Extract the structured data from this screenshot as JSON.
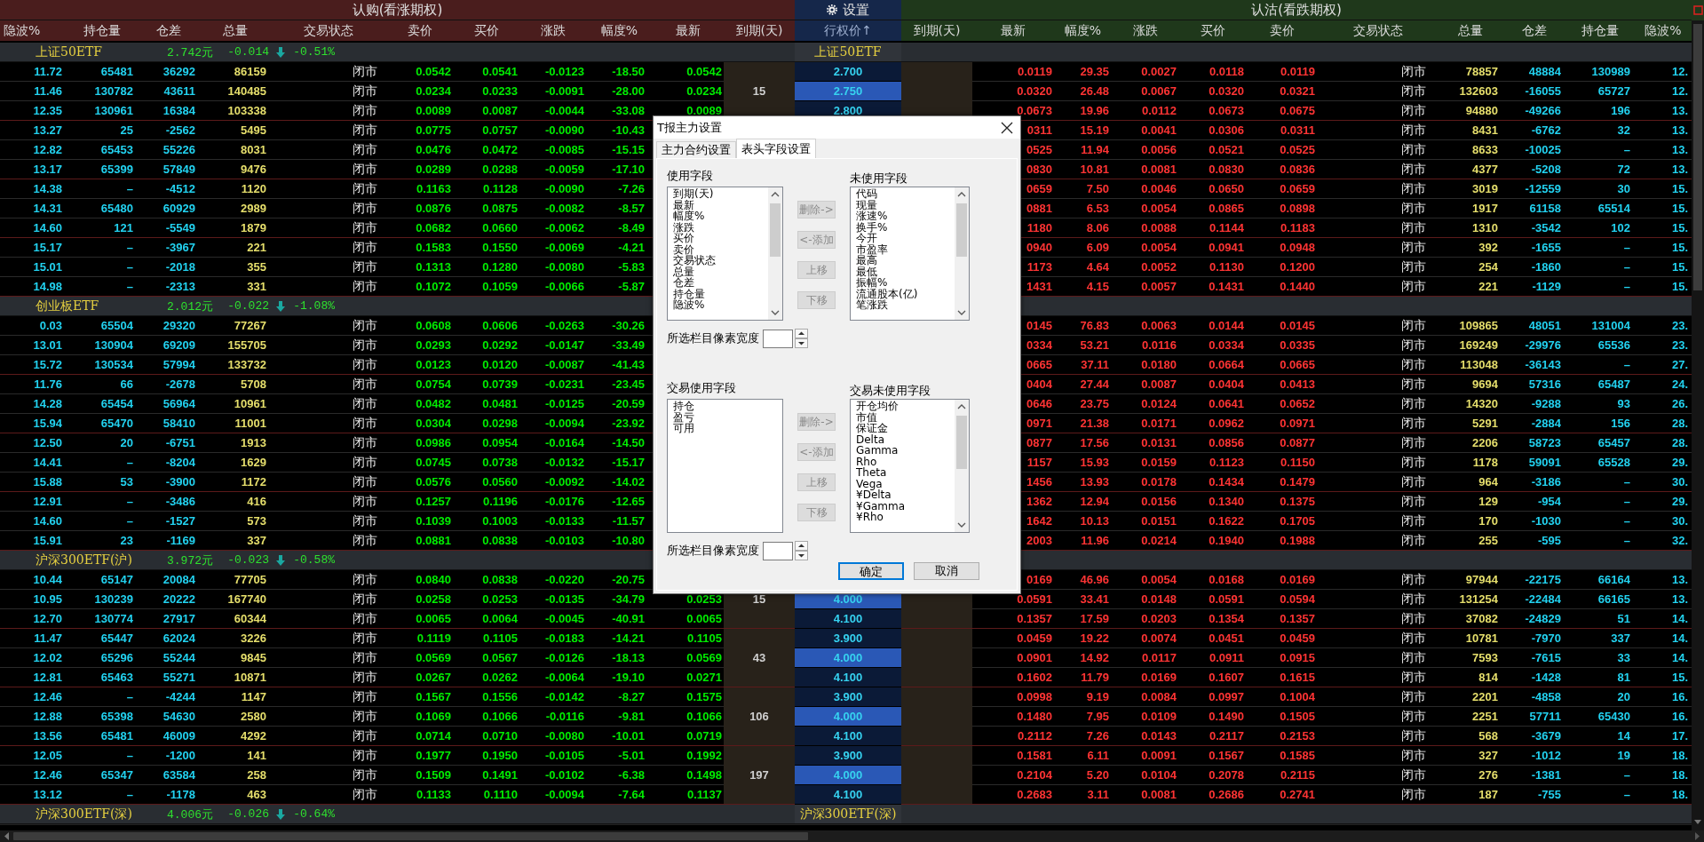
{
  "header": {
    "call_title": "认购(看涨期权)",
    "settings": "设置",
    "put_title": "认沽(看跌期权)"
  },
  "columns": {
    "call": [
      "隐波%",
      "持仓量",
      "仓差",
      "总量",
      "交易状态",
      "卖价",
      "买价",
      "涨跌",
      "幅度%",
      "最新",
      "到期(天)"
    ],
    "strike": "行权价↑",
    "put": [
      "到期(天)",
      "最新",
      "幅度%",
      "涨跌",
      "买价",
      "卖价",
      "交易状态",
      "总量",
      "仓差",
      "持仓量",
      "隐波%"
    ]
  },
  "groups": [
    {
      "name": "上证50ETF",
      "price": "2.742元",
      "change": "-0.014",
      "percent": "-0.51%",
      "strike_label": "上证50ETF",
      "rows": [
        {
          "call": [
            "11.72",
            "65481",
            "36292",
            "86159",
            "闭市",
            "0.0542",
            "0.0541",
            "-0.0123",
            "-18.50",
            "0.0542"
          ],
          "strike": "2.700",
          "atm": false,
          "put": [
            "0.0119",
            "29.35",
            "0.0027",
            "0.0118",
            "0.0119",
            "闭市",
            "78857",
            "48884",
            "130989",
            "12."
          ]
        },
        {
          "call": [
            "11.46",
            "130782",
            "43611",
            "140485",
            "闭市",
            "0.0234",
            "0.0233",
            "-0.0091",
            "-28.00",
            "0.0234"
          ],
          "expiry": "15",
          "strike": "2.750",
          "atm": true,
          "put": [
            "0.0320",
            "26.48",
            "0.0067",
            "0.0320",
            "0.0321",
            "闭市",
            "132603",
            "-16055",
            "65727",
            "12."
          ]
        },
        {
          "call": [
            "12.35",
            "130961",
            "16384",
            "103338",
            "闭市",
            "0.0089",
            "0.0087",
            "-0.0044",
            "-33.08",
            "0.0089"
          ],
          "strike": "2.800",
          "atm": false,
          "put": [
            "0.0673",
            "19.96",
            "0.0112",
            "0.0673",
            "0.0675",
            "闭市",
            "94880",
            "-49266",
            "196",
            "13."
          ]
        },
        {
          "call": [
            "13.27",
            "25",
            "-2562",
            "5495",
            "闭市",
            "0.0775",
            "0.0757",
            "-0.0090",
            "-10.43"
          ],
          "put": [
            "0311",
            "15.19",
            "0.0041",
            "0.0306",
            "0.0311",
            "闭市",
            "8431",
            "-6762",
            "32",
            "13."
          ]
        },
        {
          "call": [
            "12.82",
            "65453",
            "55226",
            "8031",
            "闭市",
            "0.0476",
            "0.0472",
            "-0.0085",
            "-15.15"
          ],
          "put": [
            "0525",
            "11.94",
            "0.0056",
            "0.0521",
            "0.0525",
            "闭市",
            "8633",
            "-10025",
            "–",
            "13."
          ]
        },
        {
          "call": [
            "13.17",
            "65399",
            "57849",
            "9476",
            "闭市",
            "0.0289",
            "0.0288",
            "-0.0059",
            "-17.10"
          ],
          "put": [
            "0830",
            "10.81",
            "0.0081",
            "0.0830",
            "0.0836",
            "闭市",
            "4377",
            "-5208",
            "72",
            "13."
          ]
        },
        {
          "call": [
            "14.38",
            "–",
            "-4512",
            "1120",
            "闭市",
            "0.1163",
            "0.1128",
            "-0.0090",
            "-7.26"
          ],
          "put": [
            "0659",
            "7.50",
            "0.0046",
            "0.0650",
            "0.0659",
            "闭市",
            "3019",
            "-12559",
            "30",
            "15."
          ]
        },
        {
          "call": [
            "14.31",
            "65480",
            "60929",
            "2989",
            "闭市",
            "0.0876",
            "0.0875",
            "-0.0082",
            "-8.57"
          ],
          "put": [
            "0881",
            "6.53",
            "0.0054",
            "0.0865",
            "0.0898",
            "闭市",
            "1917",
            "61158",
            "65514",
            "15."
          ]
        },
        {
          "call": [
            "14.60",
            "121",
            "-5549",
            "1879",
            "闭市",
            "0.0682",
            "0.0660",
            "-0.0062",
            "-8.49"
          ],
          "put": [
            "1180",
            "8.06",
            "0.0088",
            "0.1144",
            "0.1183",
            "闭市",
            "1310",
            "-3542",
            "102",
            "15."
          ]
        },
        {
          "call": [
            "15.17",
            "–",
            "-3967",
            "221",
            "闭市",
            "0.1583",
            "0.1550",
            "-0.0069",
            "-4.21"
          ],
          "put": [
            "0940",
            "6.09",
            "0.0054",
            "0.0941",
            "0.0948",
            "闭市",
            "392",
            "-1655",
            "–",
            "15."
          ]
        },
        {
          "call": [
            "15.01",
            "–",
            "-2018",
            "355",
            "闭市",
            "0.1313",
            "0.1280",
            "-0.0080",
            "-5.83"
          ],
          "put": [
            "1173",
            "4.64",
            "0.0052",
            "0.1130",
            "0.1200",
            "闭市",
            "254",
            "-1860",
            "–",
            "15."
          ]
        },
        {
          "call": [
            "14.98",
            "–",
            "-2313",
            "331",
            "闭市",
            "0.1072",
            "0.1059",
            "-0.0066",
            "-5.87"
          ],
          "put": [
            "1431",
            "4.15",
            "0.0057",
            "0.1431",
            "0.1440",
            "闭市",
            "221",
            "-1129",
            "–",
            "15."
          ]
        }
      ]
    },
    {
      "name": "创业板ETF",
      "price": "2.012元",
      "change": "-0.022",
      "percent": "-1.08%",
      "rows": [
        {
          "call": [
            "0.03",
            "65504",
            "29320",
            "77267",
            "闭市",
            "0.0608",
            "0.0606",
            "-0.0263",
            "-30.26"
          ],
          "put": [
            "0145",
            "76.83",
            "0.0063",
            "0.0144",
            "0.0145",
            "闭市",
            "109865",
            "48051",
            "131004",
            "23."
          ]
        },
        {
          "call": [
            "13.01",
            "130904",
            "69209",
            "155705",
            "闭市",
            "0.0293",
            "0.0292",
            "-0.0147",
            "-33.49"
          ],
          "put": [
            "0334",
            "53.21",
            "0.0116",
            "0.0334",
            "0.0335",
            "闭市",
            "169249",
            "-29976",
            "65536",
            "23."
          ]
        },
        {
          "call": [
            "15.72",
            "130534",
            "57994",
            "133732",
            "闭市",
            "0.0123",
            "0.0120",
            "-0.0087",
            "-41.43"
          ],
          "put": [
            "0665",
            "37.11",
            "0.0180",
            "0.0664",
            "0.0665",
            "闭市",
            "113048",
            "-36143",
            "–",
            "27."
          ]
        },
        {
          "call": [
            "11.76",
            "66",
            "-2678",
            "5708",
            "闭市",
            "0.0754",
            "0.0739",
            "-0.0231",
            "-23.45"
          ],
          "put": [
            "0404",
            "27.44",
            "0.0087",
            "0.0404",
            "0.0413",
            "闭市",
            "9694",
            "57316",
            "65487",
            "24."
          ]
        },
        {
          "call": [
            "14.28",
            "65454",
            "56964",
            "10961",
            "闭市",
            "0.0482",
            "0.0481",
            "-0.0125",
            "-20.59"
          ],
          "put": [
            "0646",
            "23.75",
            "0.0124",
            "0.0641",
            "0.0652",
            "闭市",
            "14320",
            "-9288",
            "93",
            "26."
          ]
        },
        {
          "call": [
            "15.94",
            "65470",
            "58410",
            "11001",
            "闭市",
            "0.0304",
            "0.0298",
            "-0.0094",
            "-23.92"
          ],
          "put": [
            "0971",
            "21.38",
            "0.0171",
            "0.0962",
            "0.0971",
            "闭市",
            "5291",
            "-2884",
            "156",
            "28."
          ]
        },
        {
          "call": [
            "12.50",
            "20",
            "-6751",
            "1913",
            "闭市",
            "0.0986",
            "0.0954",
            "-0.0164",
            "-14.50"
          ],
          "put": [
            "0877",
            "17.56",
            "0.0131",
            "0.0856",
            "0.0877",
            "闭市",
            "2206",
            "58723",
            "65457",
            "28."
          ]
        },
        {
          "call": [
            "14.41",
            "–",
            "-8204",
            "1629",
            "闭市",
            "0.0745",
            "0.0738",
            "-0.0132",
            "-15.17"
          ],
          "put": [
            "1157",
            "15.93",
            "0.0159",
            "0.1123",
            "0.1150",
            "闭市",
            "1178",
            "59091",
            "65528",
            "29."
          ]
        },
        {
          "call": [
            "15.88",
            "53",
            "-3900",
            "1172",
            "闭市",
            "0.0576",
            "0.0560",
            "-0.0092",
            "-14.02"
          ],
          "put": [
            "1456",
            "13.93",
            "0.0178",
            "0.1434",
            "0.1479",
            "闭市",
            "964",
            "-3186",
            "–",
            "30."
          ]
        },
        {
          "call": [
            "12.91",
            "–",
            "-3486",
            "416",
            "闭市",
            "0.1257",
            "0.1196",
            "-0.0176",
            "-12.65"
          ],
          "put": [
            "1362",
            "12.94",
            "0.0156",
            "0.1340",
            "0.1375",
            "闭市",
            "129",
            "-954",
            "–",
            "29."
          ]
        },
        {
          "call": [
            "14.60",
            "–",
            "-1527",
            "573",
            "闭市",
            "0.1039",
            "0.1003",
            "-0.0133",
            "-11.57"
          ],
          "put": [
            "1642",
            "10.13",
            "0.0151",
            "0.1622",
            "0.1705",
            "闭市",
            "170",
            "-1030",
            "–",
            "30."
          ]
        },
        {
          "call": [
            "15.91",
            "23",
            "-1169",
            "337",
            "闭市",
            "0.0881",
            "0.0838",
            "-0.0103",
            "-10.80"
          ],
          "put": [
            "2003",
            "11.96",
            "0.0214",
            "0.1940",
            "0.1988",
            "闭市",
            "255",
            "-595",
            "–",
            "32."
          ]
        }
      ]
    },
    {
      "name": "沪深300ETF(沪)",
      "price": "3.972元",
      "change": "-0.023",
      "percent": "-0.58%",
      "rows": [
        {
          "call": [
            "10.44",
            "65147",
            "20084",
            "77705",
            "闭市",
            "0.0840",
            "0.0838",
            "-0.0220",
            "-20.75"
          ],
          "put": [
            "0169",
            "46.96",
            "0.0054",
            "0.0168",
            "0.0169",
            "闭市",
            "97944",
            "-22175",
            "66164",
            "13."
          ]
        },
        {
          "call": [
            "10.95",
            "130239",
            "20222",
            "167740",
            "闭市",
            "0.0258",
            "0.0253",
            "-0.0135",
            "-34.79",
            "0.0253"
          ],
          "expiry": "15",
          "strike": "4.000",
          "atm": true,
          "put": [
            "0.0591",
            "33.41",
            "0.0148",
            "0.0591",
            "0.0594",
            "闭市",
            "131254",
            "-22484",
            "66165",
            "13."
          ]
        },
        {
          "call": [
            "12.70",
            "130774",
            "27917",
            "60344",
            "闭市",
            "0.0065",
            "0.0064",
            "-0.0045",
            "-40.91",
            "0.0065"
          ],
          "strike": "4.100",
          "atm": false,
          "put": [
            "0.1357",
            "17.59",
            "0.0203",
            "0.1354",
            "0.1357",
            "闭市",
            "37082",
            "-24829",
            "51",
            "14."
          ]
        },
        {
          "call": [
            "11.47",
            "65447",
            "62024",
            "3226",
            "闭市",
            "0.1119",
            "0.1105",
            "-0.0183",
            "-14.21",
            "0.1105"
          ],
          "strike": "3.900",
          "atm": false,
          "put": [
            "0.0459",
            "19.22",
            "0.0074",
            "0.0451",
            "0.0459",
            "闭市",
            "10781",
            "-7970",
            "337",
            "14."
          ]
        },
        {
          "call": [
            "12.02",
            "65296",
            "55244",
            "9845",
            "闭市",
            "0.0569",
            "0.0567",
            "-0.0126",
            "-18.13",
            "0.0569"
          ],
          "expiry": "43",
          "strike": "4.000",
          "atm": true,
          "put": [
            "0.0901",
            "14.92",
            "0.0117",
            "0.0911",
            "0.0915",
            "闭市",
            "7593",
            "-7615",
            "33",
            "14."
          ]
        },
        {
          "call": [
            "12.81",
            "65463",
            "55271",
            "10871",
            "闭市",
            "0.0267",
            "0.0262",
            "-0.0064",
            "-19.10",
            "0.0271"
          ],
          "strike": "4.100",
          "atm": false,
          "put": [
            "0.1602",
            "11.79",
            "0.0169",
            "0.1607",
            "0.1615",
            "闭市",
            "814",
            "-1428",
            "81",
            "15."
          ]
        },
        {
          "call": [
            "12.46",
            "–",
            "-4244",
            "1147",
            "闭市",
            "0.1567",
            "0.1556",
            "-0.0142",
            "-8.27",
            "0.1575"
          ],
          "strike": "3.900",
          "atm": false,
          "put": [
            "0.0998",
            "9.19",
            "0.0084",
            "0.0997",
            "0.1004",
            "闭市",
            "2201",
            "-4858",
            "20",
            "16."
          ]
        },
        {
          "call": [
            "12.88",
            "65398",
            "54630",
            "2580",
            "闭市",
            "0.1069",
            "0.1066",
            "-0.0116",
            "-9.81",
            "0.1066"
          ],
          "expiry": "106",
          "strike": "4.000",
          "atm": true,
          "put": [
            "0.1480",
            "7.95",
            "0.0109",
            "0.1490",
            "0.1505",
            "闭市",
            "2251",
            "57711",
            "65430",
            "16."
          ]
        },
        {
          "call": [
            "13.56",
            "65481",
            "46009",
            "4292",
            "闭市",
            "0.0714",
            "0.0710",
            "-0.0080",
            "-10.01",
            "0.0719"
          ],
          "strike": "4.100",
          "atm": false,
          "put": [
            "0.2112",
            "7.26",
            "0.0143",
            "0.2117",
            "0.2153",
            "闭市",
            "568",
            "-3679",
            "14",
            "17."
          ]
        },
        {
          "call": [
            "12.05",
            "–",
            "-1200",
            "141",
            "闭市",
            "0.1977",
            "0.1950",
            "-0.0105",
            "-5.01",
            "0.1992"
          ],
          "strike": "3.900",
          "atm": false,
          "put": [
            "0.1581",
            "6.11",
            "0.0091",
            "0.1567",
            "0.1585",
            "闭市",
            "327",
            "-1012",
            "19",
            "18."
          ]
        },
        {
          "call": [
            "12.46",
            "65347",
            "63584",
            "258",
            "闭市",
            "0.1509",
            "0.1491",
            "-0.0102",
            "-6.38",
            "0.1498"
          ],
          "expiry": "197",
          "strike": "4.000",
          "atm": true,
          "put": [
            "0.2104",
            "5.20",
            "0.0104",
            "0.2078",
            "0.2115",
            "闭市",
            "276",
            "-1381",
            "–",
            "18."
          ]
        },
        {
          "call": [
            "13.12",
            "–",
            "-1178",
            "463",
            "闭市",
            "0.1133",
            "0.1110",
            "-0.0094",
            "-7.64",
            "0.1137"
          ],
          "strike": "4.100",
          "atm": false,
          "put": [
            "0.2683",
            "3.11",
            "0.0081",
            "0.2686",
            "0.2741",
            "闭市",
            "187",
            "-755",
            "–",
            "18."
          ]
        }
      ]
    },
    {
      "name": "沪深300ETF(深)",
      "price": "4.006元",
      "change": "-0.026",
      "percent": "-0.64%",
      "strike_label": "沪深300ETF(深)"
    }
  ],
  "dialog": {
    "title": "T报主力设置",
    "tabs": [
      {
        "label": "主力合约设置",
        "selected": false
      },
      {
        "label": "表头字段设置",
        "selected": true
      }
    ],
    "sections": [
      {
        "used_label": "使用字段",
        "used": [
          "到期(天)",
          "最新",
          "幅度%",
          "涨跌",
          "买价",
          "卖价",
          "交易状态",
          "总量",
          "仓差",
          "持仓量",
          "隐波%"
        ],
        "unused_label": "未使用字段",
        "unused": [
          "代码",
          "现量",
          "涨速%",
          "换手%",
          "今开",
          "市盈率",
          "最高",
          "最低",
          "振幅%",
          "流通股本(亿)",
          "笔涨跌"
        ],
        "buttons": [
          {
            "label": "删除->",
            "disabled": true
          },
          {
            "label": "<-添加",
            "disabled": true
          },
          {
            "label": "上移",
            "disabled": true
          },
          {
            "label": "下移",
            "disabled": true
          }
        ],
        "width_label": "所选栏目像素宽度"
      },
      {
        "used_label": "交易使用字段",
        "used": [
          "持仓",
          "盈亏",
          "可用"
        ],
        "unused_label": "交易未使用字段",
        "unused": [
          "开仓均价",
          "市值",
          "保证金",
          "Delta",
          "Gamma",
          "Rho",
          "Theta",
          "Vega",
          "¥Delta",
          "¥Gamma",
          "¥Rho"
        ],
        "buttons": [
          {
            "label": "删除->",
            "disabled": true
          },
          {
            "label": "<-添加",
            "disabled": true
          },
          {
            "label": "上移",
            "disabled": true
          },
          {
            "label": "下移",
            "disabled": true
          }
        ],
        "width_label": "所选栏目像素宽度"
      }
    ],
    "buttons": [
      {
        "label": "确定",
        "default": true
      },
      {
        "label": "取消",
        "default": false
      }
    ]
  }
}
